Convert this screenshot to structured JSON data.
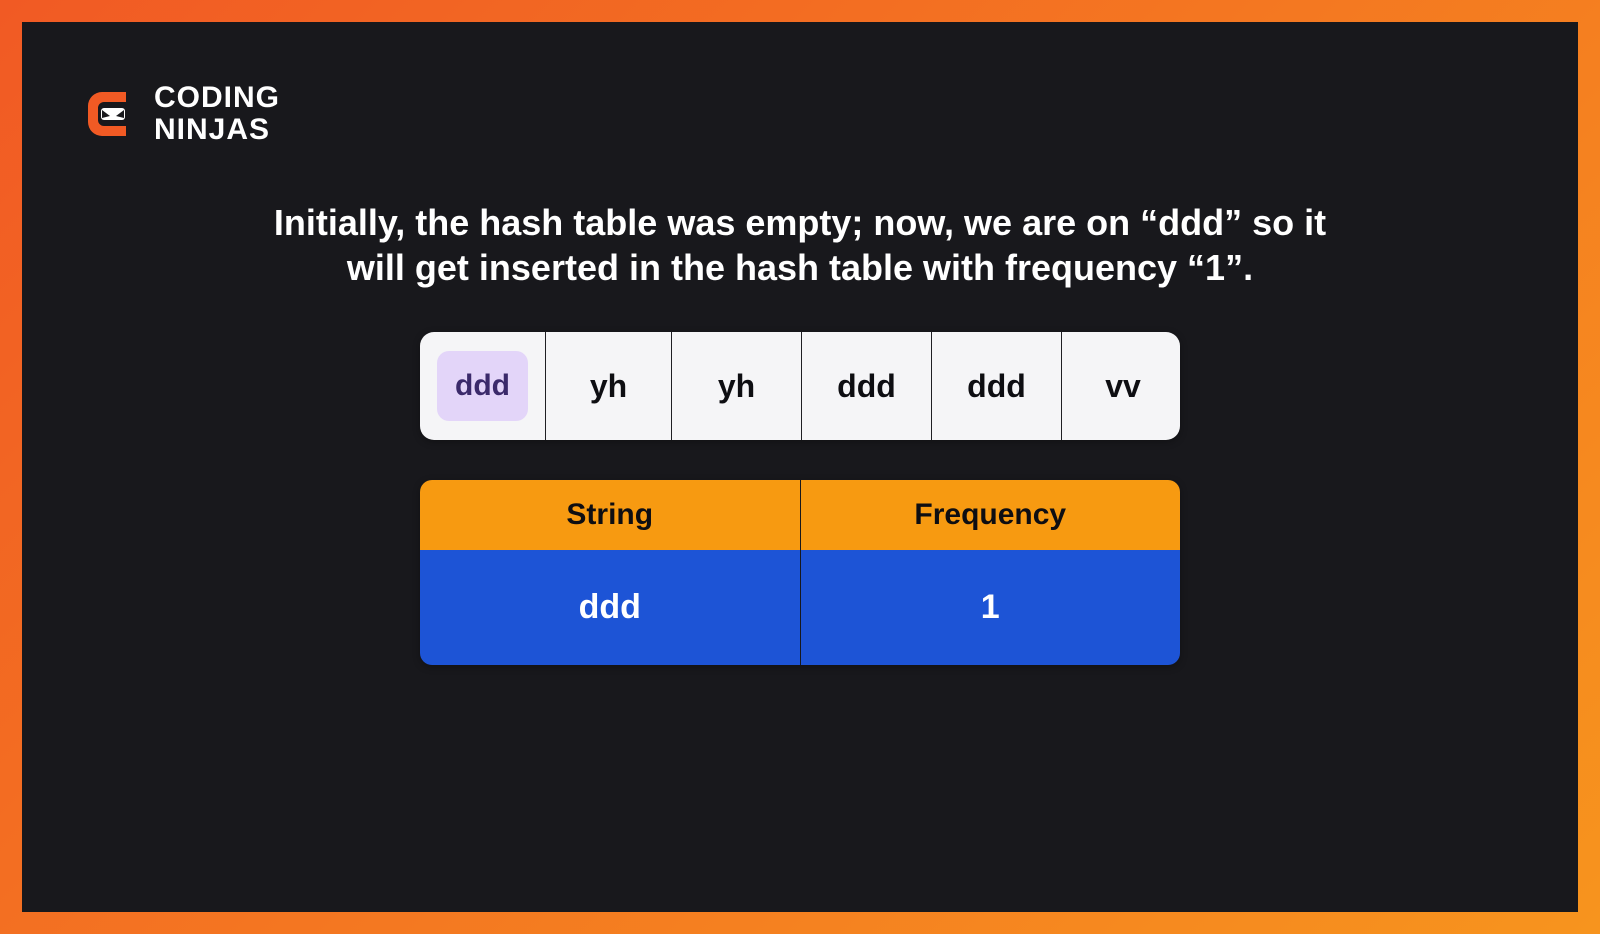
{
  "brand": {
    "line1": "CODING",
    "line2": "NINJAS"
  },
  "explanation": "Initially, the hash table was empty; now, we are on “ddd” so it will get inserted in the hash table with frequency “1”.",
  "array": {
    "items": [
      "ddd",
      "yh",
      "yh",
      "ddd",
      "ddd",
      "vv"
    ],
    "highlight_index": 0
  },
  "hash_table": {
    "headers": [
      "String",
      "Frequency"
    ],
    "rows": [
      {
        "string": "ddd",
        "frequency": "1"
      }
    ]
  },
  "colors": {
    "frame_bg": "#18181c",
    "border_gradient_start": "#f15a24",
    "border_gradient_end": "#f7941e",
    "header_bg": "#f79a11",
    "row_bg": "#1d54d6",
    "highlight_bg": "#e3d5f9",
    "highlight_fg": "#3b2a6b"
  }
}
